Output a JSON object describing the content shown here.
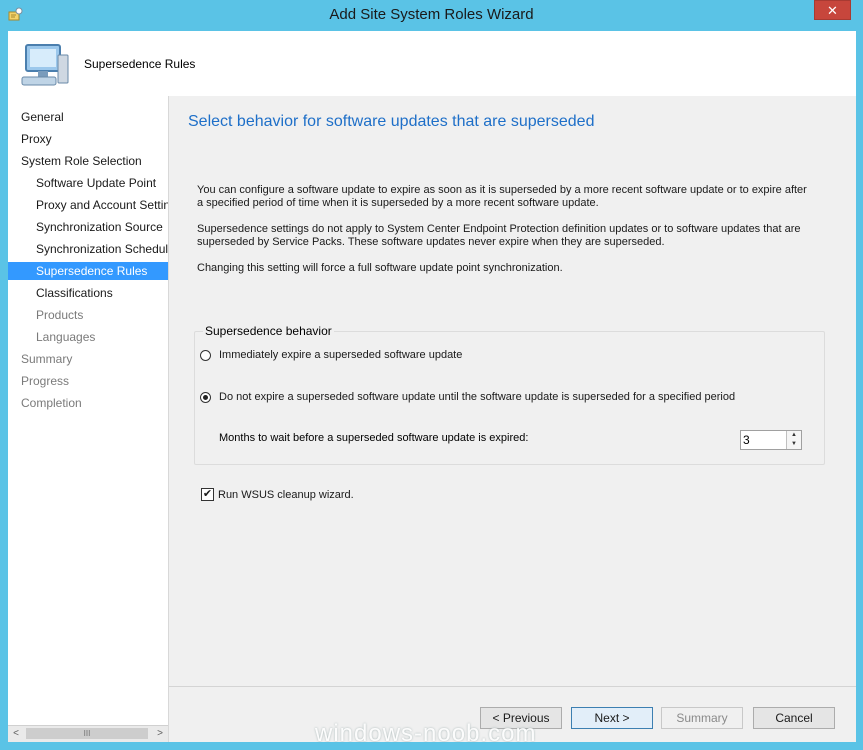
{
  "window": {
    "title": "Add Site System Roles Wizard",
    "close_glyph": "✕"
  },
  "header": {
    "title": "Supersedence Rules"
  },
  "nav": {
    "items": [
      {
        "label": "General",
        "state": "normal"
      },
      {
        "label": "Proxy",
        "state": "normal"
      },
      {
        "label": "System Role Selection",
        "state": "normal"
      },
      {
        "label": "Software Update Point",
        "state": "normal"
      },
      {
        "label": "Proxy and Account Settin",
        "state": "normal"
      },
      {
        "label": "Synchronization Source",
        "state": "normal"
      },
      {
        "label": "Synchronization Schedule",
        "state": "normal"
      },
      {
        "label": "Supersedence Rules",
        "state": "selected"
      },
      {
        "label": "Classifications",
        "state": "normal"
      },
      {
        "label": "Products",
        "state": "disabled"
      },
      {
        "label": "Languages",
        "state": "disabled"
      },
      {
        "label": "Summary",
        "state": "disabled"
      },
      {
        "label": "Progress",
        "state": "disabled"
      },
      {
        "label": "Completion",
        "state": "disabled"
      }
    ],
    "scroll_left": "<",
    "scroll_right": ">",
    "scroll_grip": "III"
  },
  "main": {
    "title": "Select behavior for software updates that are superseded",
    "para1": "You can configure a software update to expire as soon as it is superseded by a more recent software update or to expire after a specified period of time when it is superseded by a more recent software update.",
    "para2": "Supersedence settings do not apply to System Center Endpoint Protection definition updates or to software updates that are superseded by Service Packs. These software updates never expire when they are superseded.",
    "para3": "Changing this setting will force a full software update point synchronization.",
    "group_label": "Supersedence behavior",
    "radio1": {
      "label": "Immediately expire a superseded software update",
      "checked": false
    },
    "radio2": {
      "label": "Do not expire a superseded software update until the software update is superseded for a specified period",
      "checked": true
    },
    "months_label": "Months to wait before a superseded software update is expired:",
    "months_value": "3",
    "cleanup": {
      "label": "Run WSUS cleanup wizard.",
      "checked": true
    }
  },
  "footer": {
    "previous": "< Previous",
    "next": "Next >",
    "summary": "Summary",
    "cancel": "Cancel"
  },
  "watermark": "windows-noob.com",
  "colors": {
    "titlebar": "#5ac3e6",
    "selected": "#3399ff",
    "heading": "#1e6fc8",
    "close": "#c7463c"
  }
}
